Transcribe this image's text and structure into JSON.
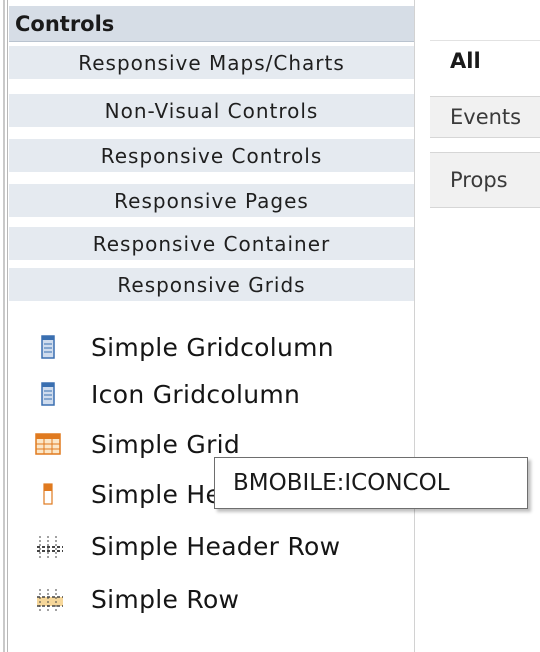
{
  "panel": {
    "title": "Controls",
    "categories": [
      {
        "label": "Responsive Maps/Charts"
      },
      {
        "label": "Non-Visual Controls"
      },
      {
        "label": "Responsive Controls"
      },
      {
        "label": "Responsive Pages"
      },
      {
        "label": "Responsive Container"
      },
      {
        "label": "Responsive Grids"
      }
    ],
    "items": [
      {
        "label": "Simple Gridcolumn",
        "icon": "gridcolumn-icon"
      },
      {
        "label": "Icon Gridcolumn",
        "icon": "icon-gridcolumn-icon"
      },
      {
        "label": "Simple Grid",
        "icon": "grid-icon"
      },
      {
        "label": "Simple He",
        "icon": "header-icon"
      },
      {
        "label": "Simple Header Row",
        "icon": "header-row-icon"
      },
      {
        "label": "Simple Row",
        "icon": "row-icon"
      }
    ]
  },
  "tabs": [
    {
      "label": "All",
      "active": true
    },
    {
      "label": "Events",
      "active": false
    },
    {
      "label": "Props",
      "active": false
    }
  ],
  "tooltip": {
    "text": "BMOBILE:ICONCOL"
  },
  "colors": {
    "header_bg": "#d6dde6",
    "category_bg": "#e5eaf0",
    "icon_blue": "#3a6fb0",
    "icon_orange": "#e07a1f"
  }
}
